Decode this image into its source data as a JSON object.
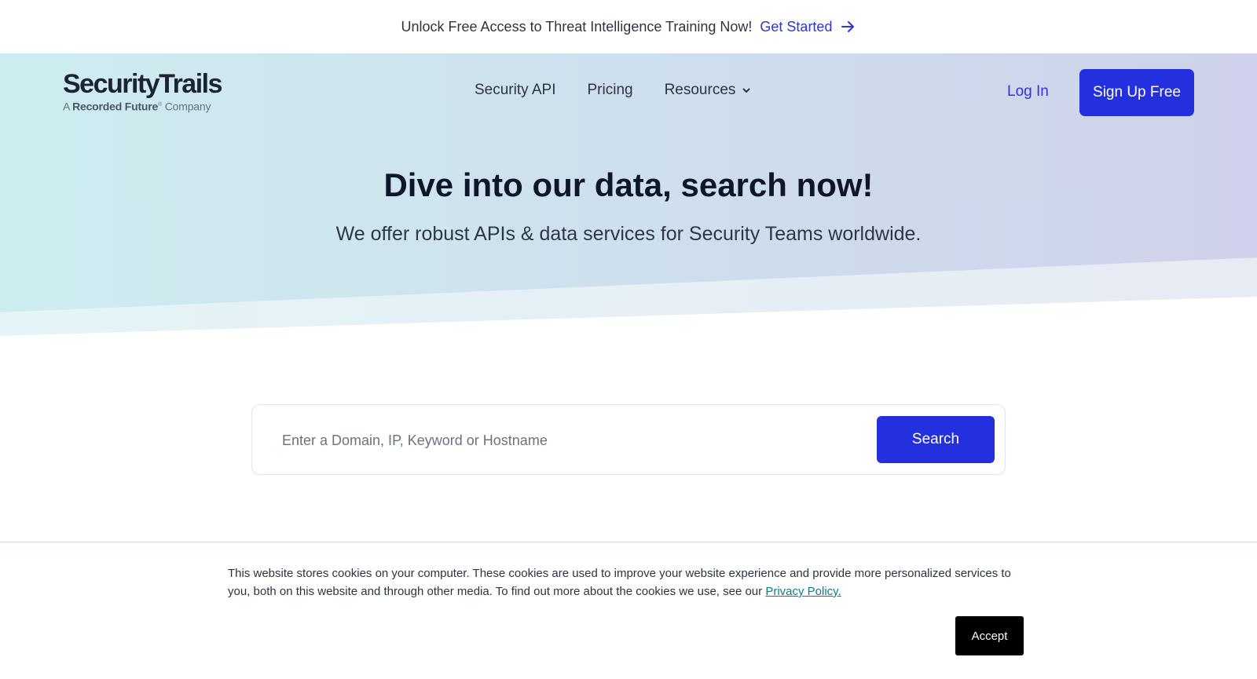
{
  "announcement": {
    "message": "Unlock Free Access to Threat Intelligence Training Now!",
    "cta_label": "Get Started",
    "cta_icon": "arrow-right-icon"
  },
  "logo": {
    "brand": "SecurityTrails",
    "sub_prefix": "A",
    "sub_company": "Recorded Future",
    "sub_suffix": "Company"
  },
  "nav": {
    "items": [
      {
        "label": "Security API"
      },
      {
        "label": "Pricing"
      },
      {
        "label": "Resources",
        "icon": "chevron-down-icon"
      }
    ],
    "login_label": "Log In",
    "signup_label": "Sign Up Free"
  },
  "hero": {
    "title": "Dive into our data, search now!",
    "subtitle": "We offer robust APIs & data services for Security Teams worldwide."
  },
  "search": {
    "placeholder": "Enter a Domain, IP, Keyword or Hostname",
    "value": "",
    "button_label": "Search"
  },
  "cookie": {
    "text": "This website stores cookies on your computer. These cookies are used to improve your website experience and provide more personalized services to you, both on this website and through other media. To find out more about the cookies we use, see our ",
    "link_label": "Privacy Policy.",
    "accept_label": "Accept"
  },
  "colors": {
    "accent": "#2430dd",
    "hero_left": "#cdedf0",
    "hero_right": "#cfd2ea",
    "text_dark": "#0f1629"
  }
}
